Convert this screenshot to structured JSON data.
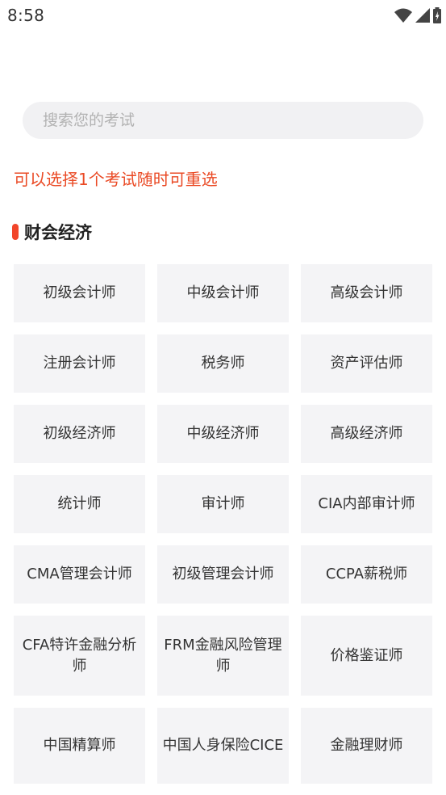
{
  "status_bar": {
    "time": "8:58",
    "icons": [
      "wifi-icon",
      "cellular-signal-icon",
      "battery-charging-icon"
    ]
  },
  "search": {
    "placeholder": "搜索您的考试"
  },
  "hint": "可以选择1个考试随时可重选",
  "section": {
    "title": "财会经济",
    "accent_color": "#f2452a",
    "items": [
      "初级会计师",
      "中级会计师",
      "高级会计师",
      "注册会计师",
      "税务师",
      "资产评估师",
      "初级经济师",
      "中级经济师",
      "高级经济师",
      "统计师",
      "审计师",
      "CIA内部审计师",
      "CMA管理会计师",
      "初级管理会计师",
      "CCPA薪税师",
      "CFA特许金融分析师",
      "FRM金融风险管理师",
      "价格鉴证师",
      "中国精算师",
      "中国人身保险CICE",
      "金融理财师"
    ]
  },
  "colors": {
    "hint_text": "#ea4a25",
    "tile_background": "#f4f4f6",
    "search_background": "#f1f1f3"
  }
}
